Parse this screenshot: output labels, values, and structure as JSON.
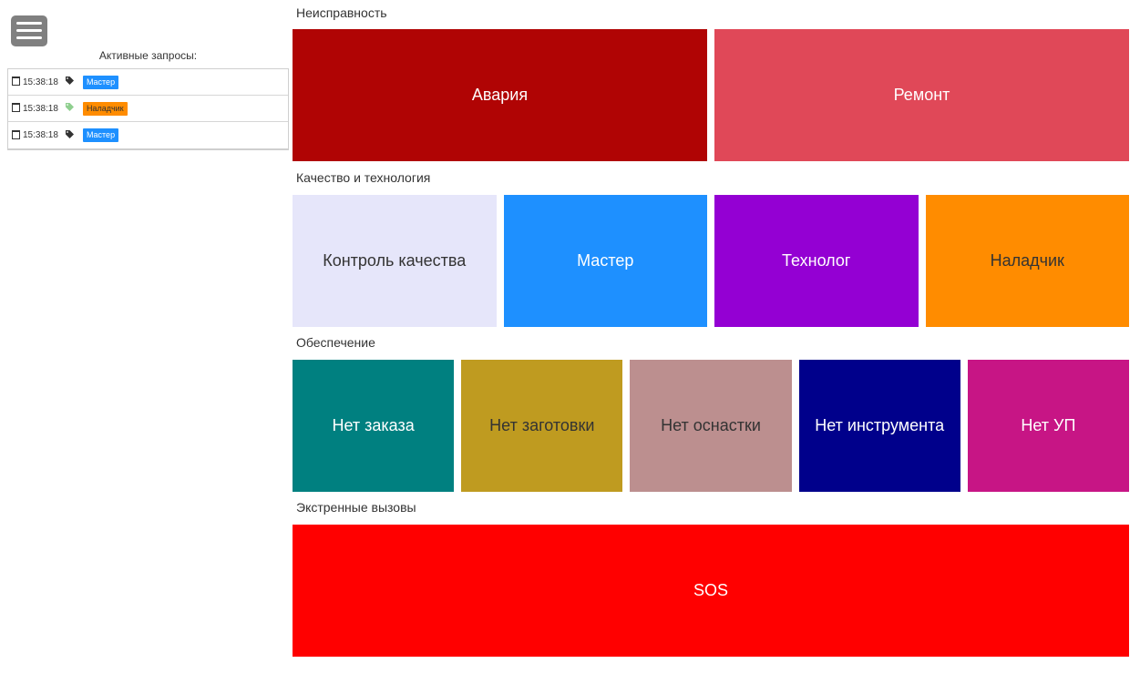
{
  "sidebar": {
    "active_requests_title": "Активные запросы:",
    "requests": [
      {
        "time": "15:38:18",
        "tag_color": "#333333",
        "badge": "Мастер",
        "badge_bg": "#1E90FF",
        "badge_fg": "#ffffff"
      },
      {
        "time": "15:38:18",
        "tag_color": "#8fcf8f",
        "badge": "Наладчик",
        "badge_bg": "#FF8C00",
        "badge_fg": "#333333"
      },
      {
        "time": "15:38:18",
        "tag_color": "#333333",
        "badge": "Мастер",
        "badge_bg": "#1E90FF",
        "badge_fg": "#ffffff"
      }
    ]
  },
  "sections": [
    {
      "title": "Неисправность",
      "tiles": [
        {
          "label": "Авария",
          "bg": "#B00404",
          "fg": "#ffffff"
        },
        {
          "label": "Ремонт",
          "bg": "#E04858",
          "fg": "#ffffff"
        }
      ]
    },
    {
      "title": "Качество и технология",
      "tiles": [
        {
          "label": "Контроль качества",
          "bg": "#E6E6FA",
          "fg": "#333333"
        },
        {
          "label": "Мастер",
          "bg": "#1E90FF",
          "fg": "#ffffff"
        },
        {
          "label": "Технолог",
          "bg": "#9400D3",
          "fg": "#ffffff"
        },
        {
          "label": "Наладчик",
          "bg": "#FF8C00",
          "fg": "#333333"
        }
      ]
    },
    {
      "title": "Обеспечение",
      "tiles": [
        {
          "label": "Нет заказа",
          "bg": "#008080",
          "fg": "#ffffff"
        },
        {
          "label": "Нет заготовки",
          "bg": "#BF9B20",
          "fg": "#333333"
        },
        {
          "label": "Нет оснастки",
          "bg": "#BC8F8F",
          "fg": "#333333"
        },
        {
          "label": "Нет инструмента",
          "bg": "#00008B",
          "fg": "#ffffff"
        },
        {
          "label": "Нет УП",
          "bg": "#C71585",
          "fg": "#ffffff"
        }
      ]
    },
    {
      "title": "Экстренные вызовы",
      "tiles": [
        {
          "label": "SOS",
          "bg": "#FF0000",
          "fg": "#ffffff"
        }
      ]
    }
  ]
}
